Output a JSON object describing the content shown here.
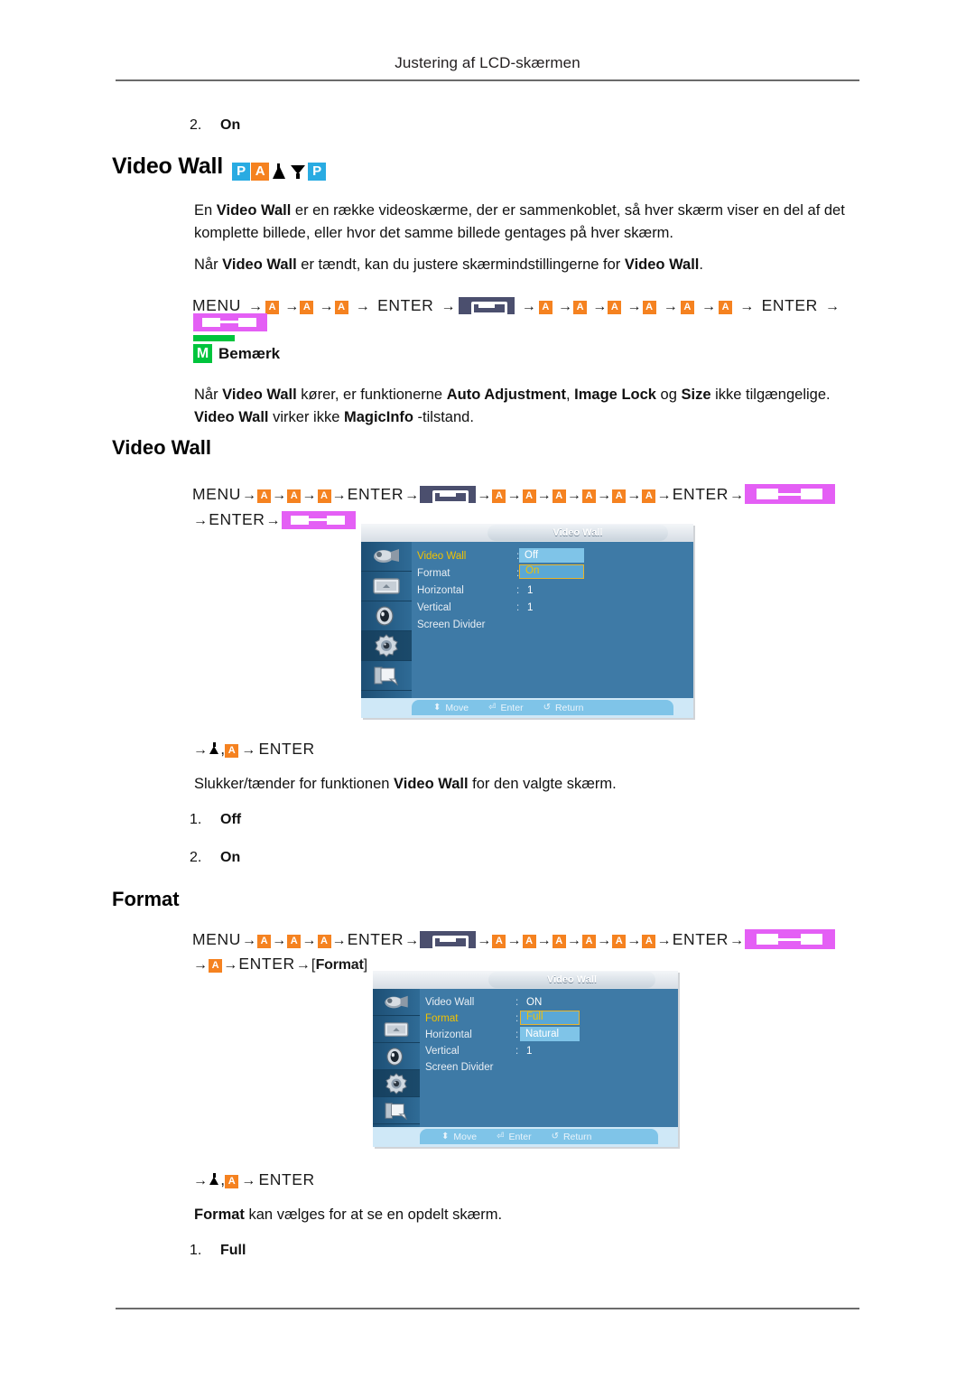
{
  "page": {
    "running_head": "Justering af LCD-skærmen"
  },
  "top_item": {
    "num": "2.",
    "label": "On"
  },
  "section1": {
    "title": "Video Wall",
    "badges": [
      "P",
      "A",
      "triangle",
      "funnel",
      "P"
    ],
    "paragraph1_parts": [
      "En ",
      "Video Wall",
      " er en række videoskærme, der er sammenkoblet, så hver skærm viser en del af det komplette billede, eller hvor det samme billede gentages på hver skærm."
    ],
    "paragraph2_parts": [
      "Når ",
      "Video Wall",
      " er tændt, kan du justere skærmindstillingerne for ",
      "Video Wall",
      "."
    ],
    "nav": {
      "menu": "MENU",
      "enter": "ENTER",
      "arrow": "→",
      "comma": ","
    },
    "note": {
      "icon_letter": "M",
      "label": "Bemærk",
      "text_parts": [
        "Når ",
        "Video Wall",
        " kører, er funktionerne ",
        "Auto Adjustment",
        ", ",
        "Image Lock",
        " og ",
        "Size",
        " ikke tilgængelige. ",
        "Video Wall",
        " virker ikke ",
        "MagicInfo",
        " -tilstand."
      ]
    }
  },
  "section2": {
    "title": "Video Wall",
    "after_osd_line": "→ ▲ , → ENTER",
    "description_parts": [
      "Slukker/tænder for funktionen ",
      "Video Wall",
      " for den valgte skærm."
    ],
    "options": [
      {
        "num": "1.",
        "label": "Off"
      },
      {
        "num": "2.",
        "label": "On"
      }
    ],
    "osd": {
      "title": "Video Wall",
      "rows": [
        {
          "label": "Video Wall",
          "highlight": true,
          "colon": ":",
          "value": ""
        },
        {
          "label": "Format",
          "highlight": false,
          "colon": ":",
          "value": ""
        },
        {
          "label": "Horizontal",
          "highlight": false,
          "colon": ":",
          "value": "1"
        },
        {
          "label": "Vertical",
          "highlight": false,
          "colon": ":",
          "value": "1"
        },
        {
          "label": "Screen Divider",
          "highlight": false,
          "colon": "",
          "value": ""
        }
      ],
      "dropdown": [
        {
          "label": "Off",
          "selected": false
        },
        {
          "label": "On",
          "selected": true
        }
      ],
      "footer": [
        {
          "glyph": "⬍",
          "label": "Move"
        },
        {
          "glyph": "⏎",
          "label": "Enter"
        },
        {
          "glyph": "↺",
          "label": "Return"
        }
      ],
      "sidebar_icons": [
        "picture-icon",
        "screen-icon",
        "sound-icon",
        "setup-icon",
        "multi-control-icon"
      ],
      "selected_sidebar_index": 3
    }
  },
  "section3": {
    "title": "Format",
    "format_token": "Format",
    "after_osd_line": "→ ▲ , → ENTER",
    "description_parts": [
      "Format",
      " kan vælges for at se en opdelt skærm."
    ],
    "options": [
      {
        "num": "1.",
        "label": "Full"
      }
    ],
    "osd": {
      "title": "Video Wall",
      "rows": [
        {
          "label": "Video Wall",
          "highlight": false,
          "colon": ":",
          "value": "ON"
        },
        {
          "label": "Format",
          "highlight": true,
          "colon": ":",
          "value": ""
        },
        {
          "label": "Horizontal",
          "highlight": false,
          "colon": ":",
          "value": ""
        },
        {
          "label": "Vertical",
          "highlight": false,
          "colon": ":",
          "value": "1"
        },
        {
          "label": "Screen Divider",
          "highlight": false,
          "colon": "",
          "value": ""
        }
      ],
      "dropdown": [
        {
          "label": "Full",
          "selected": true
        },
        {
          "label": "Natural",
          "selected": false
        }
      ],
      "footer": [
        {
          "glyph": "⬍",
          "label": "Move"
        },
        {
          "glyph": "⏎",
          "label": "Enter"
        },
        {
          "glyph": "↺",
          "label": "Return"
        }
      ],
      "sidebar_icons": [
        "picture-icon",
        "screen-icon",
        "sound-icon",
        "setup-icon",
        "multi-control-icon"
      ],
      "selected_sidebar_index": 3
    }
  },
  "colors": {
    "key_orange": "#f58220",
    "badge_blue": "#29abe2",
    "note_green": "#00c43c",
    "magenta_bar": "#e45ff5",
    "navy_bar": "#4b4f6e",
    "osd_blue": "#3e7aa6",
    "osd_highlight": "#f2c200"
  }
}
